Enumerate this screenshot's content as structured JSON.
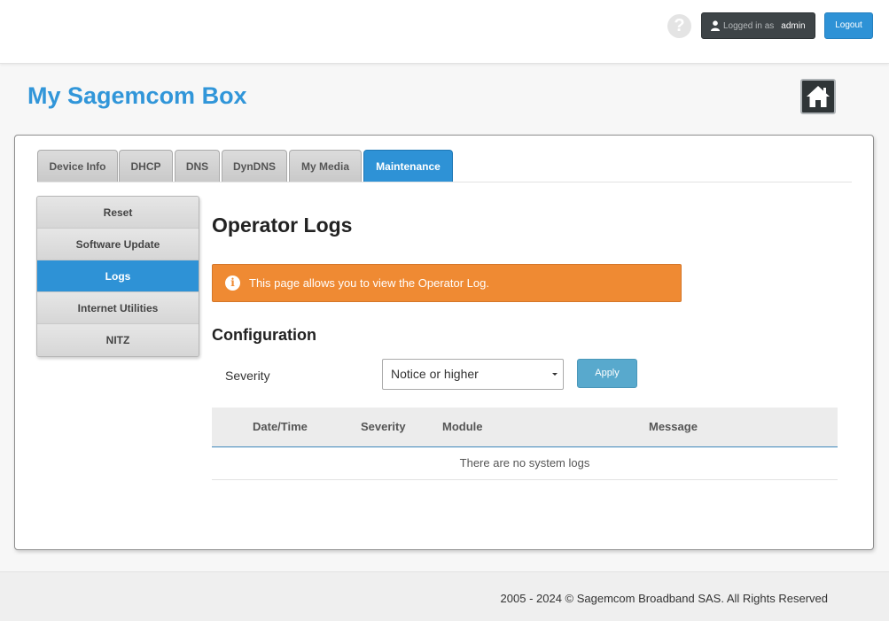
{
  "header": {
    "help_icon": "?",
    "logged_in_label": "Logged in as",
    "username": "admin",
    "logout_label": "Logout"
  },
  "brand": {
    "title": "My Sagemcom Box"
  },
  "tabs": [
    {
      "label": "Device Info"
    },
    {
      "label": "DHCP"
    },
    {
      "label": "DNS"
    },
    {
      "label": "DynDNS"
    },
    {
      "label": "My Media"
    },
    {
      "label": "Maintenance",
      "active": true
    }
  ],
  "sidebar": {
    "items": [
      {
        "label": "Reset"
      },
      {
        "label": "Software Update"
      },
      {
        "label": "Logs",
        "active": true
      },
      {
        "label": "Internet Utilities"
      },
      {
        "label": "NITZ"
      }
    ]
  },
  "main": {
    "page_title": "Operator Logs",
    "info_icon": "i",
    "info_text": "This page allows you to view the Operator Log.",
    "section_title": "Configuration",
    "severity_label": "Severity",
    "severity_selected": "Notice or higher",
    "apply_label": "Apply",
    "table": {
      "columns": [
        "Date/Time",
        "Severity",
        "Module",
        "Message"
      ],
      "empty_text": "There are no system logs"
    }
  },
  "footer": {
    "copyright": "2005 - 2024 © Sagemcom Broadband SAS. All Rights Reserved"
  },
  "colors": {
    "brand_blue": "#3196d9",
    "active_blue": "#2e92d6",
    "banner_orange": "#ef8a33",
    "apply_blue": "#58a9cd"
  }
}
